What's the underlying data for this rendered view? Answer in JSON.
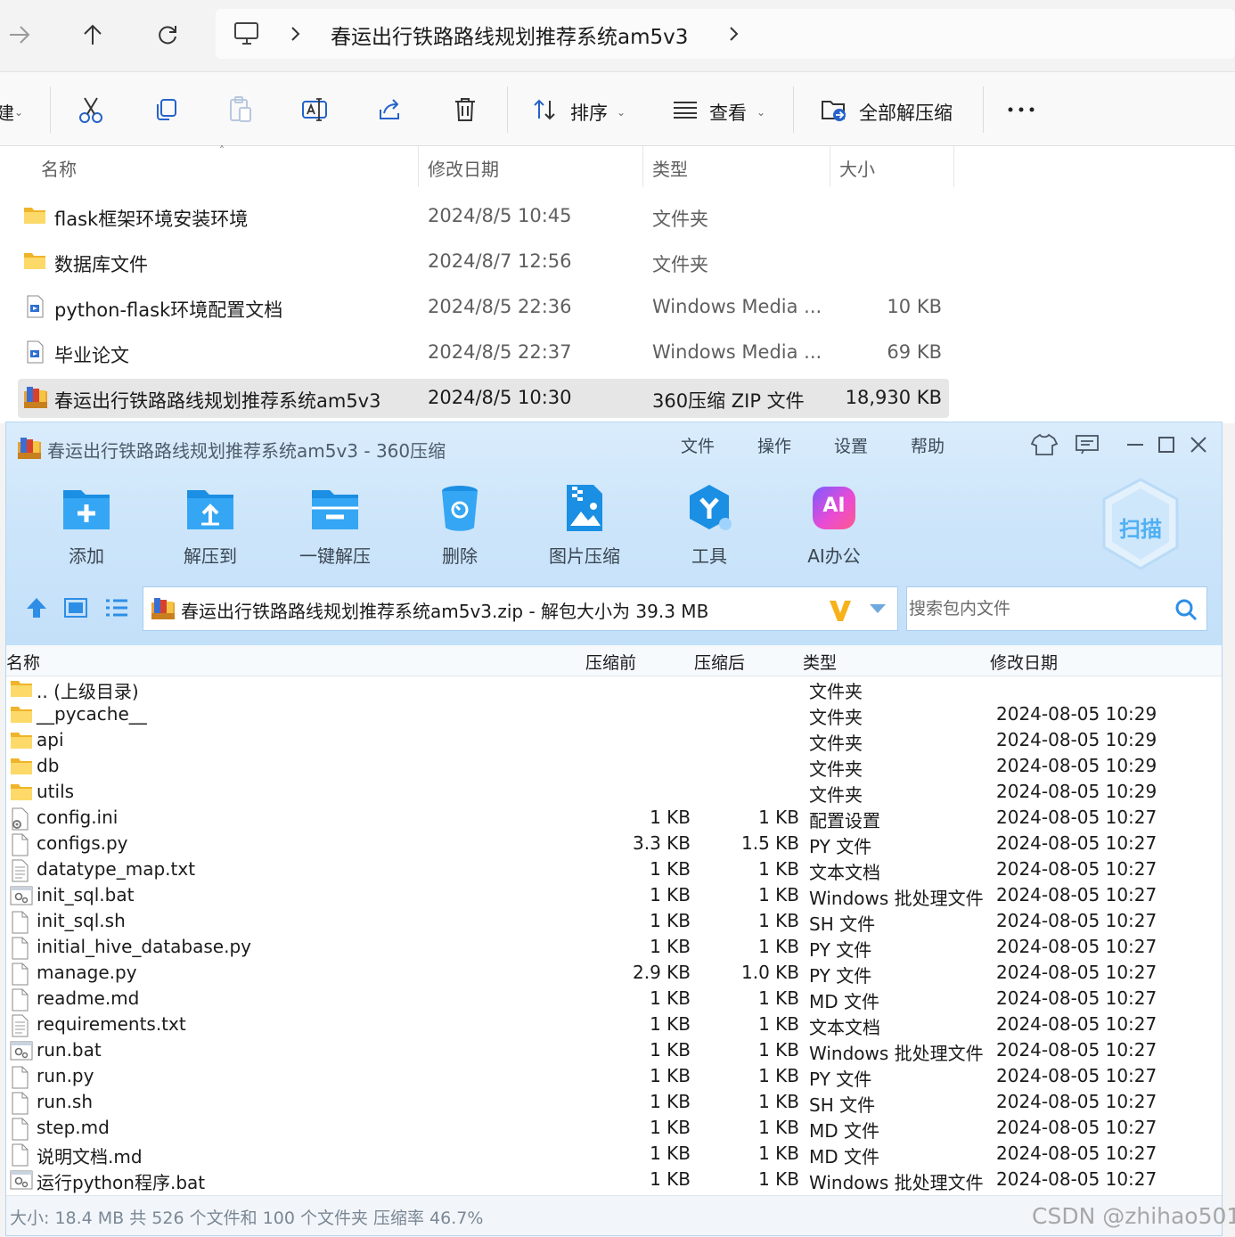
{
  "explorer": {
    "path": "春运出行铁路路线规划推荐系统am5v3",
    "toolbar": {
      "sort_label": "排序",
      "view_label": "查看",
      "extract_all_label": "全部解压缩"
    },
    "columns": {
      "name": "名称",
      "date": "修改日期",
      "type": "类型",
      "size": "大小"
    },
    "files": [
      {
        "name": "flask框架环境安装环境",
        "date": "2024/8/5 10:45",
        "type": "文件夹",
        "size": "",
        "icon": "folder-icon"
      },
      {
        "name": "数据库文件",
        "date": "2024/8/7 12:56",
        "type": "文件夹",
        "size": "",
        "icon": "folder-icon"
      },
      {
        "name": "python-flask环境配置文档",
        "date": "2024/8/5 22:36",
        "type": "Windows Media ...",
        "size": "10 KB",
        "icon": "media-file-icon"
      },
      {
        "name": "毕业论文",
        "date": "2024/8/5 22:37",
        "type": "Windows Media ...",
        "size": "69 KB",
        "icon": "media-file-icon"
      },
      {
        "name": "春运出行铁路路线规划推荐系统am5v3",
        "date": "2024/8/5 10:30",
        "type": "360压缩 ZIP 文件",
        "size": "18,930 KB",
        "icon": "zip-archive-icon",
        "selected": true
      }
    ]
  },
  "zip": {
    "title": "春运出行铁路路线规划推荐系统am5v3 - 360压缩",
    "menu": [
      "文件",
      "操作",
      "设置",
      "帮助"
    ],
    "buttons": [
      {
        "label": "添加",
        "icon": "add-folder-icon"
      },
      {
        "label": "解压到",
        "icon": "extract-to-icon"
      },
      {
        "label": "一键解压",
        "icon": "one-click-extract-icon"
      },
      {
        "label": "删除",
        "icon": "delete-bin-icon"
      },
      {
        "label": "图片压缩",
        "icon": "image-compress-icon"
      },
      {
        "label": "工具",
        "icon": "tools-icon"
      },
      {
        "label": "AI办公",
        "icon": "ai-office-icon"
      }
    ],
    "ai_badge": "AI",
    "scan_label": "扫描",
    "path": "春运出行铁路路线规划推荐系统am5v3.zip - 解包大小为 39.3 MB",
    "search_placeholder": "搜索包内文件",
    "columns": {
      "name": "名称",
      "before": "压缩前",
      "after": "压缩后",
      "type": "类型",
      "date": "修改日期"
    },
    "rows": [
      {
        "name": ".. (上级目录)",
        "before": "",
        "after": "",
        "type": "文件夹",
        "date": "",
        "icon": "folder-icon"
      },
      {
        "name": "__pycache__",
        "before": "",
        "after": "",
        "type": "文件夹",
        "date": "2024-08-05 10:29",
        "icon": "folder-icon"
      },
      {
        "name": "api",
        "before": "",
        "after": "",
        "type": "文件夹",
        "date": "2024-08-05 10:29",
        "icon": "folder-icon"
      },
      {
        "name": "db",
        "before": "",
        "after": "",
        "type": "文件夹",
        "date": "2024-08-05 10:29",
        "icon": "folder-icon"
      },
      {
        "name": "utils",
        "before": "",
        "after": "",
        "type": "文件夹",
        "date": "2024-08-05 10:29",
        "icon": "folder-icon"
      },
      {
        "name": "config.ini",
        "before": "1 KB",
        "after": "1 KB",
        "type": "配置设置",
        "date": "2024-08-05 10:27",
        "icon": "config-file-icon"
      },
      {
        "name": "configs.py",
        "before": "3.3 KB",
        "after": "1.5 KB",
        "type": "PY 文件",
        "date": "2024-08-05 10:27",
        "icon": "file-icon"
      },
      {
        "name": "datatype_map.txt",
        "before": "1 KB",
        "after": "1 KB",
        "type": "文本文档",
        "date": "2024-08-05 10:27",
        "icon": "text-file-icon"
      },
      {
        "name": "init_sql.bat",
        "before": "1 KB",
        "after": "1 KB",
        "type": "Windows 批处理文件",
        "date": "2024-08-05 10:27",
        "icon": "batch-file-icon"
      },
      {
        "name": "init_sql.sh",
        "before": "1 KB",
        "after": "1 KB",
        "type": "SH 文件",
        "date": "2024-08-05 10:27",
        "icon": "file-icon"
      },
      {
        "name": "initial_hive_database.py",
        "before": "1 KB",
        "after": "1 KB",
        "type": "PY 文件",
        "date": "2024-08-05 10:27",
        "icon": "file-icon"
      },
      {
        "name": "manage.py",
        "before": "2.9 KB",
        "after": "1.0 KB",
        "type": "PY 文件",
        "date": "2024-08-05 10:27",
        "icon": "file-icon"
      },
      {
        "name": "readme.md",
        "before": "1 KB",
        "after": "1 KB",
        "type": "MD 文件",
        "date": "2024-08-05 10:27",
        "icon": "file-icon"
      },
      {
        "name": "requirements.txt",
        "before": "1 KB",
        "after": "1 KB",
        "type": "文本文档",
        "date": "2024-08-05 10:27",
        "icon": "text-file-icon"
      },
      {
        "name": "run.bat",
        "before": "1 KB",
        "after": "1 KB",
        "type": "Windows 批处理文件",
        "date": "2024-08-05 10:27",
        "icon": "batch-file-icon"
      },
      {
        "name": "run.py",
        "before": "1 KB",
        "after": "1 KB",
        "type": "PY 文件",
        "date": "2024-08-05 10:27",
        "icon": "file-icon"
      },
      {
        "name": "run.sh",
        "before": "1 KB",
        "after": "1 KB",
        "type": "SH 文件",
        "date": "2024-08-05 10:27",
        "icon": "file-icon"
      },
      {
        "name": "step.md",
        "before": "1 KB",
        "after": "1 KB",
        "type": "MD 文件",
        "date": "2024-08-05 10:27",
        "icon": "file-icon"
      },
      {
        "name": "说明文档.md",
        "before": "1 KB",
        "after": "1 KB",
        "type": "MD 文件",
        "date": "2024-08-05 10:27",
        "icon": "file-icon"
      },
      {
        "name": "运行python程序.bat",
        "before": "1 KB",
        "after": "1 KB",
        "type": "Windows 批处理文件",
        "date": "2024-08-05 10:27",
        "icon": "batch-file-icon"
      }
    ],
    "status": "大小: 18.4 MB 共 526 个文件和 100 个文件夹 压缩率 46.7%"
  },
  "watermark": "CSDN @zhihao501",
  "colors": {
    "folder": "#f7c948",
    "accent_blue": "#1a8fe3",
    "zip_header": "#cde5fa",
    "selected_row": "#e6e6e6"
  }
}
